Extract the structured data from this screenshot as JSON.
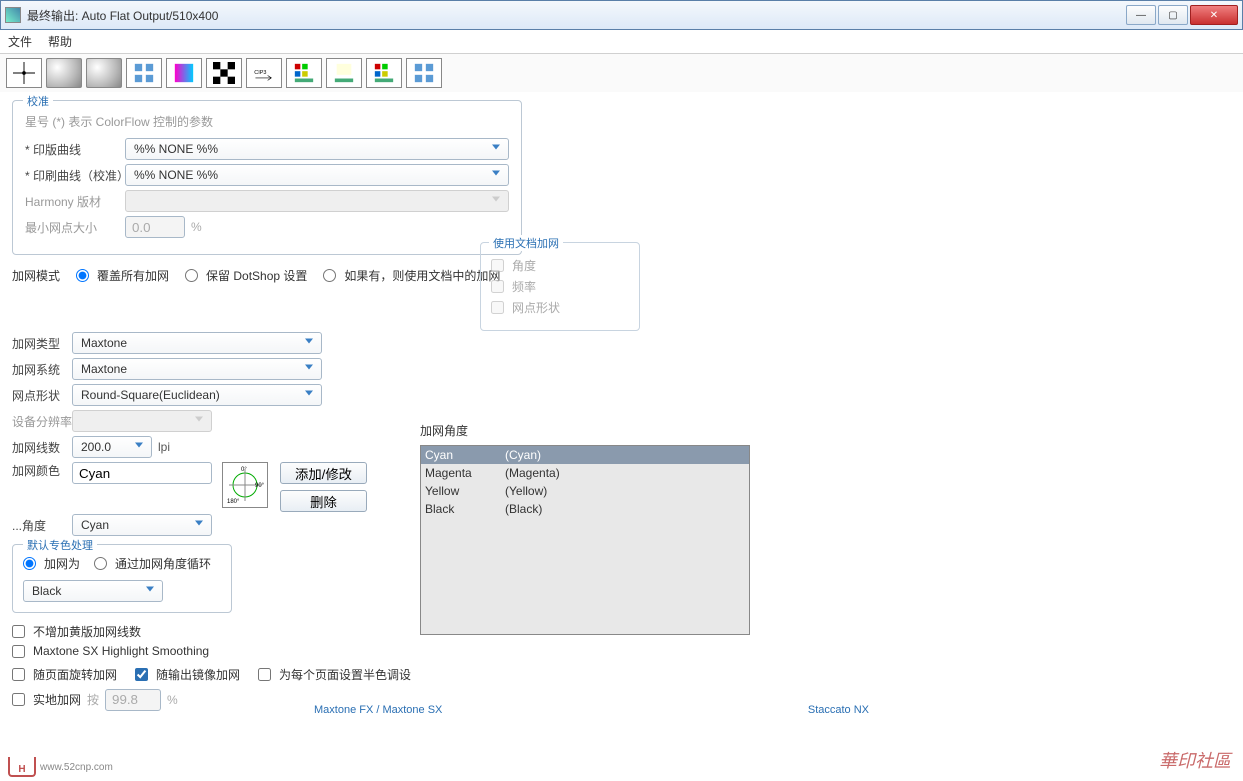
{
  "window": {
    "title": "最终输出: Auto Flat Output/510x400",
    "min": "—",
    "max": "▢",
    "close": "✕"
  },
  "menu": {
    "file": "文件",
    "help": "帮助"
  },
  "calib": {
    "legend": "校准",
    "note": "星号 (*) 表示 ColorFlow 控制的参数",
    "plate_curve_label": "* 印版曲线",
    "plate_curve_value": "%% NONE %%",
    "print_curve_label": "* 印刷曲线（校准）",
    "print_curve_value": "%% NONE %%",
    "harmony_label": "Harmony 版材",
    "mindot_label": "最小网点大小",
    "mindot_value": "0.0",
    "mindot_unit": "%"
  },
  "mode": {
    "label": "加网模式",
    "opt1": "覆盖所有加网",
    "opt2": "保留 DotShop 设置",
    "opt3": "如果有，则使用文档中的加网"
  },
  "docscreen": {
    "legend": "使用文档加网",
    "angle": "角度",
    "freq": "频率",
    "shape": "网点形状"
  },
  "lower": {
    "type_label": "加网类型",
    "type_value": "Maxtone",
    "system_label": "加网系统",
    "system_value": "Maxtone",
    "shape_label": "网点形状",
    "shape_value": "Round-Square(Euclidean)",
    "res_label": "设备分辨率",
    "lines_label": "加网线数",
    "lines_value": "200.0",
    "lines_unit": "lpi",
    "color_label": "加网颜色",
    "color_value": "Cyan",
    "angle_label": "...角度",
    "angle_value": "Cyan",
    "btn_add": "添加/修改",
    "btn_delete": "删除"
  },
  "spot": {
    "legend": "默认专色处理",
    "opt1": "加网为",
    "opt2": "通过加网角度循环",
    "value": "Black"
  },
  "checks": {
    "cb1": "不增加黄版加网线数",
    "cb2": "Maxtone SX Highlight Smoothing",
    "cb3": "随页面旋转加网",
    "cb4": "随输出镜像加网",
    "cb5": "为每个页面设置半色调设",
    "cb6": "实地加网",
    "cb6_suffix": "按",
    "cb6_value": "99.8",
    "cb6_unit": "%"
  },
  "angle_list": {
    "label": "加网角度",
    "rows": [
      {
        "name": "Cyan",
        "map": "(Cyan)"
      },
      {
        "name": "Magenta",
        "map": "(Magenta)"
      },
      {
        "name": "Yellow",
        "map": "(Yellow)"
      },
      {
        "name": "Black",
        "map": "(Black)"
      }
    ]
  },
  "footer": {
    "left": "Maxtone FX / Maxtone SX",
    "right": "Staccato NX"
  },
  "watermark": {
    "text": "華印社區",
    "url": "www.52cnp.com"
  }
}
